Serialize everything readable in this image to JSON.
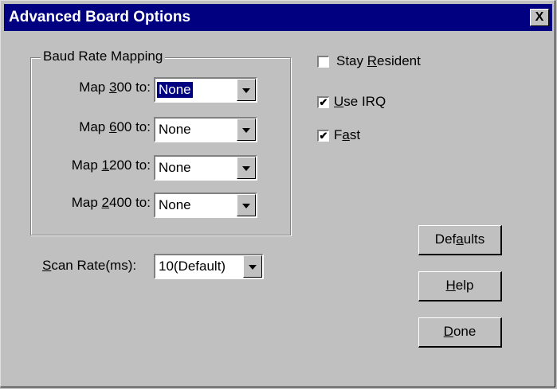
{
  "window": {
    "title": "Advanced Board Options",
    "close_glyph": "X"
  },
  "baud_group": {
    "label": "Baud Rate Mapping",
    "rows": [
      {
        "pre": "Map ",
        "accel": "3",
        "post": "00 to:",
        "value": "None",
        "selected": true
      },
      {
        "pre": "Map ",
        "accel": "6",
        "post": "00 to:",
        "value": "None",
        "selected": false
      },
      {
        "pre": "Map ",
        "accel": "1",
        "post": "200 to:",
        "value": "None",
        "selected": false
      },
      {
        "pre": "Map ",
        "accel": "2",
        "post": "400 to:",
        "value": "None",
        "selected": false
      }
    ]
  },
  "scan_rate": {
    "accel": "S",
    "post": "can Rate(ms):",
    "value": "10(Default)"
  },
  "options": [
    {
      "pre": "Stay ",
      "accel": "R",
      "post": "esident",
      "checked": false
    },
    {
      "pre": "",
      "accel": "U",
      "post": "se IRQ",
      "checked": true
    },
    {
      "pre": "F",
      "accel": "a",
      "post": "st",
      "checked": true
    }
  ],
  "buttons": [
    {
      "pre": "Def",
      "accel": "a",
      "post": "ults"
    },
    {
      "pre": "",
      "accel": "H",
      "post": "elp"
    },
    {
      "pre": "",
      "accel": "D",
      "post": "one"
    }
  ],
  "check_glyph": "✔"
}
